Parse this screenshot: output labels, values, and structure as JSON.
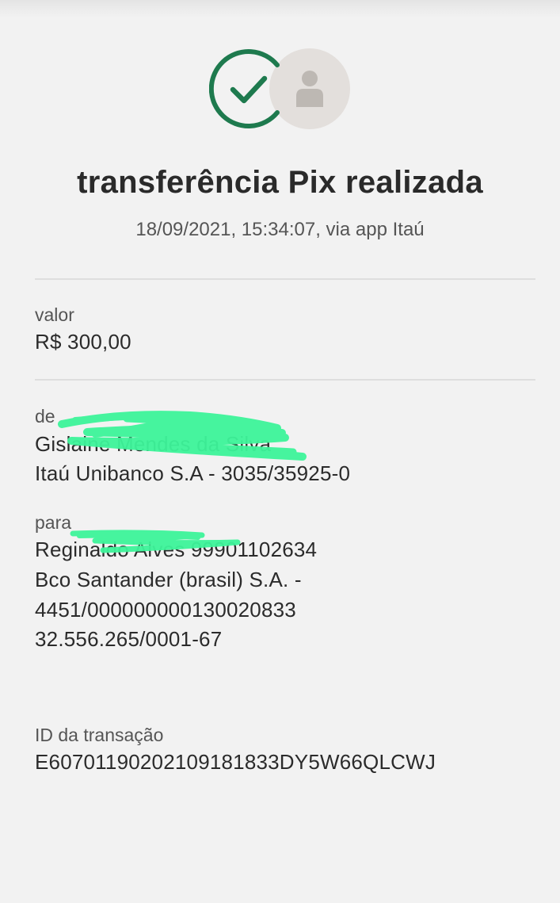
{
  "header": {
    "success_icon": "check-circle-icon",
    "recipient_icon": "person-avatar-icon",
    "title": "transferência Pix realizada",
    "subtitle": "18/09/2021,  15:34:07, via app Itaú"
  },
  "valor": {
    "label": "valor",
    "amount": "R$ 300,00"
  },
  "de": {
    "label": "de",
    "name": "Gislaine Mendes da Silva",
    "bank_account": "Itaú Unibanco S.A - 3035/35925-0"
  },
  "para": {
    "label": "para",
    "name": "Reginaldo Alves 99901102634",
    "bank_line1": "Bco Santander (brasil) S.A. -",
    "bank_line2": "4451/000000000130020833",
    "document": "32.556.265/0001-67"
  },
  "transacao": {
    "label": "ID da transação",
    "id": "E60701190202109181833DY5W66QLCWJ"
  },
  "colors": {
    "success_green": "#1e7a4e",
    "scribble_green": "#3df59a",
    "avatar_bg": "#e3dfdc"
  }
}
